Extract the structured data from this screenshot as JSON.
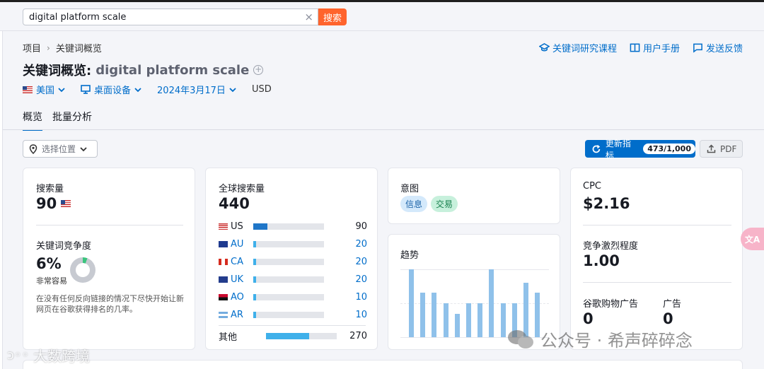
{
  "search": {
    "value": "digital platform scale",
    "clear": "×",
    "button": "搜索"
  },
  "breadcrumb": {
    "root": "项目",
    "sep": "›",
    "current": "关键词概览"
  },
  "help_links": {
    "course": "关键词研究课程",
    "manual": "用户手册",
    "feedback": "发送反馈"
  },
  "title": {
    "prefix": "关键词概览:",
    "keyword": "digital platform scale",
    "add": "+"
  },
  "filters": {
    "country": "美国",
    "device": "桌面设备",
    "date": "2024年3月17日",
    "currency": "USD"
  },
  "tabs": [
    {
      "label": "概览",
      "active": true
    },
    {
      "label": "批量分析",
      "active": false
    }
  ],
  "location_select": {
    "label": "选择位置"
  },
  "update_button": {
    "label": "更新指标",
    "count": "473/1,000"
  },
  "pdf_button": {
    "label": "PDF"
  },
  "volume_card": {
    "label": "搜索量",
    "value": "90",
    "kd_label": "关键词竞争度",
    "kd_value": "6%",
    "kd_level": "非常容易",
    "kd_percent": 6,
    "kd_desc_1": "在没有任何反向链接的情况下尽快开始让新",
    "kd_desc_2": "网页在谷歌获得排名的几率。"
  },
  "global_card": {
    "label": "全球搜索量",
    "value": "440",
    "rows": [
      {
        "country": "US",
        "value": "90",
        "fill_fraction": 0.2,
        "color": "#1f76c8",
        "flag": "us"
      },
      {
        "country": "AU",
        "value": "20",
        "fill_fraction": 0.04,
        "color": "#3fb0ea",
        "flag": "au"
      },
      {
        "country": "CA",
        "value": "20",
        "fill_fraction": 0.04,
        "color": "#3fb0ea",
        "flag": "ca"
      },
      {
        "country": "UK",
        "value": "20",
        "fill_fraction": 0.04,
        "color": "#3fb0ea",
        "flag": "uk"
      },
      {
        "country": "AO",
        "value": "10",
        "fill_fraction": 0.02,
        "color": "#3fb0ea",
        "flag": "ao"
      },
      {
        "country": "AR",
        "value": "10",
        "fill_fraction": 0.02,
        "color": "#3fb0ea",
        "flag": "ar"
      }
    ],
    "other_label": "其他",
    "other_value": "270",
    "other_fill": 0.61
  },
  "intent_card": {
    "label": "意图",
    "badges": [
      {
        "text": "信息",
        "bg": "#d4e9fb",
        "fg": "#1c64a8"
      },
      {
        "text": "交易",
        "bg": "#c7f0dc",
        "fg": "#17804d"
      }
    ]
  },
  "trend_card": {
    "label": "趋势",
    "values": [
      1.0,
      0.66,
      0.66,
      0.5,
      0.34,
      0.5,
      0.5,
      1.0,
      0.5,
      0.5,
      0.8,
      0.66
    ]
  },
  "cpc_card": {
    "cpc_label": "CPC",
    "cpc_value": "$2.16",
    "comp_label": "竞争激烈程度",
    "comp_value": "1.00",
    "shopping_label": "谷歌购物广告",
    "shopping_value": "0",
    "ads_label": "广告",
    "ads_value": "0"
  },
  "watermarks": {
    "right": "公众号 · 希声碎碎念",
    "left": "大数跨境"
  },
  "translate_fab": "文A",
  "colors": {
    "accent": "#006dca",
    "search_button": "#ff642d",
    "trend_bar": "#8fc1ea"
  }
}
